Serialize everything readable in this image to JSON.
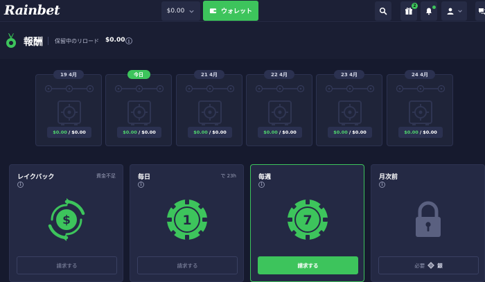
{
  "topbar": {
    "logo": "Rainbet",
    "balance": "$0.00",
    "wallet_label": "ウォレット",
    "gift_count": "2"
  },
  "header": {
    "title": "報酬",
    "reload_label": "保留中のリロード",
    "reload_value": "$0.00"
  },
  "calendar": {
    "days": [
      {
        "label": "19 4月",
        "today": false,
        "earned": "$0.00",
        "total": "$0.00"
      },
      {
        "label": "今日",
        "today": true,
        "earned": "$0.00",
        "total": "$0.00"
      },
      {
        "label": "21 4月",
        "today": false,
        "earned": "$0.00",
        "total": "$0.00"
      },
      {
        "label": "22 4月",
        "today": false,
        "earned": "$0.00",
        "total": "$0.00"
      },
      {
        "label": "23 4月",
        "today": false,
        "earned": "$0.00",
        "total": "$0.00"
      },
      {
        "label": "24 4月",
        "today": false,
        "earned": "$0.00",
        "total": "$0.00"
      }
    ],
    "separator": "/"
  },
  "cards": [
    {
      "title": "レイクバック",
      "note": "資金不足",
      "icon": "rakeback-dollar-icon",
      "button": "請求する"
    },
    {
      "title": "毎日",
      "note": "で 23h",
      "icon": "daily-chip-icon",
      "chip_number": "1",
      "button": "請求する"
    },
    {
      "title": "毎週",
      "note": "",
      "icon": "weekly-chip-icon",
      "chip_number": "7",
      "button": "請求する"
    },
    {
      "title": "月次前",
      "note": "",
      "icon": "lock-icon",
      "button_prefix": "必要",
      "button_suffix": "銀"
    }
  ],
  "colors": {
    "accent": "#3dc45c",
    "background": "#161a2e",
    "card": "#242944"
  }
}
